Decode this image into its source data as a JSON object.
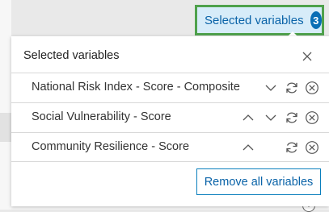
{
  "header_button": {
    "label": "Selected variables",
    "count": "3"
  },
  "panel": {
    "title": "Selected variables",
    "variables": [
      {
        "name": "National Risk Index - Score - Composite"
      },
      {
        "name": "Social Vulnerability - Score"
      },
      {
        "name": "Community Resilience - Score"
      }
    ],
    "remove_all_label": "Remove all variables"
  },
  "colors": {
    "accent": "#0a6eb5",
    "highlight_border": "#4fa14c",
    "button_bg": "#d7ecf9"
  },
  "icons": [
    "close-icon",
    "chevron-up-icon",
    "chevron-down-icon",
    "refresh-icon",
    "remove-icon",
    "info-icon"
  ],
  "background": {
    "info_glyph": "i"
  }
}
